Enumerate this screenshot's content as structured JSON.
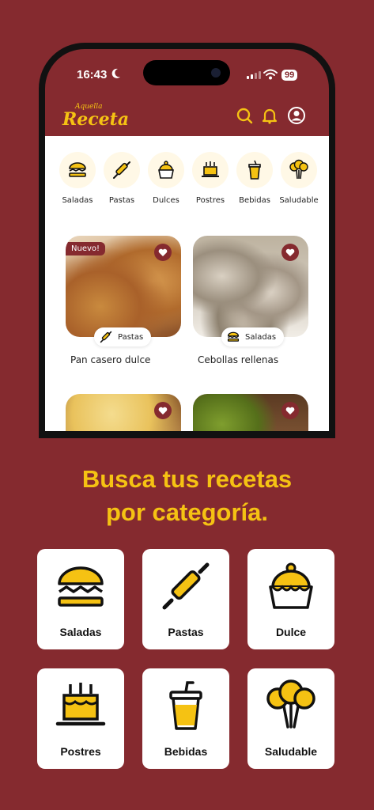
{
  "status": {
    "time": "16:43",
    "battery": "99"
  },
  "app": {
    "logo_small": "Aquella",
    "logo_big": "Receta"
  },
  "categories": [
    {
      "label": "Saladas",
      "icon": "burger-icon"
    },
    {
      "label": "Pastas",
      "icon": "rolling-pin-icon"
    },
    {
      "label": "Dulces",
      "icon": "cupcake-icon"
    },
    {
      "label": "Postres",
      "icon": "cake-icon"
    },
    {
      "label": "Bebidas",
      "icon": "drink-cup-icon"
    },
    {
      "label": "Saludable",
      "icon": "broccoli-icon"
    }
  ],
  "recipes": [
    {
      "title": "Pan casero dulce",
      "category": "Pastas",
      "badge": "Nuevo!"
    },
    {
      "title": "Cebollas rellenas",
      "category": "Saladas"
    }
  ],
  "headline": {
    "line1": "Busca tus recetas",
    "line2": "por categoría."
  },
  "tiles": [
    {
      "label": "Saladas"
    },
    {
      "label": "Pastas"
    },
    {
      "label": "Dulce"
    },
    {
      "label": "Postres"
    },
    {
      "label": "Bebidas"
    },
    {
      "label": "Saludable"
    }
  ],
  "colors": {
    "brand": "#852a2f",
    "accent": "#f5c213"
  }
}
